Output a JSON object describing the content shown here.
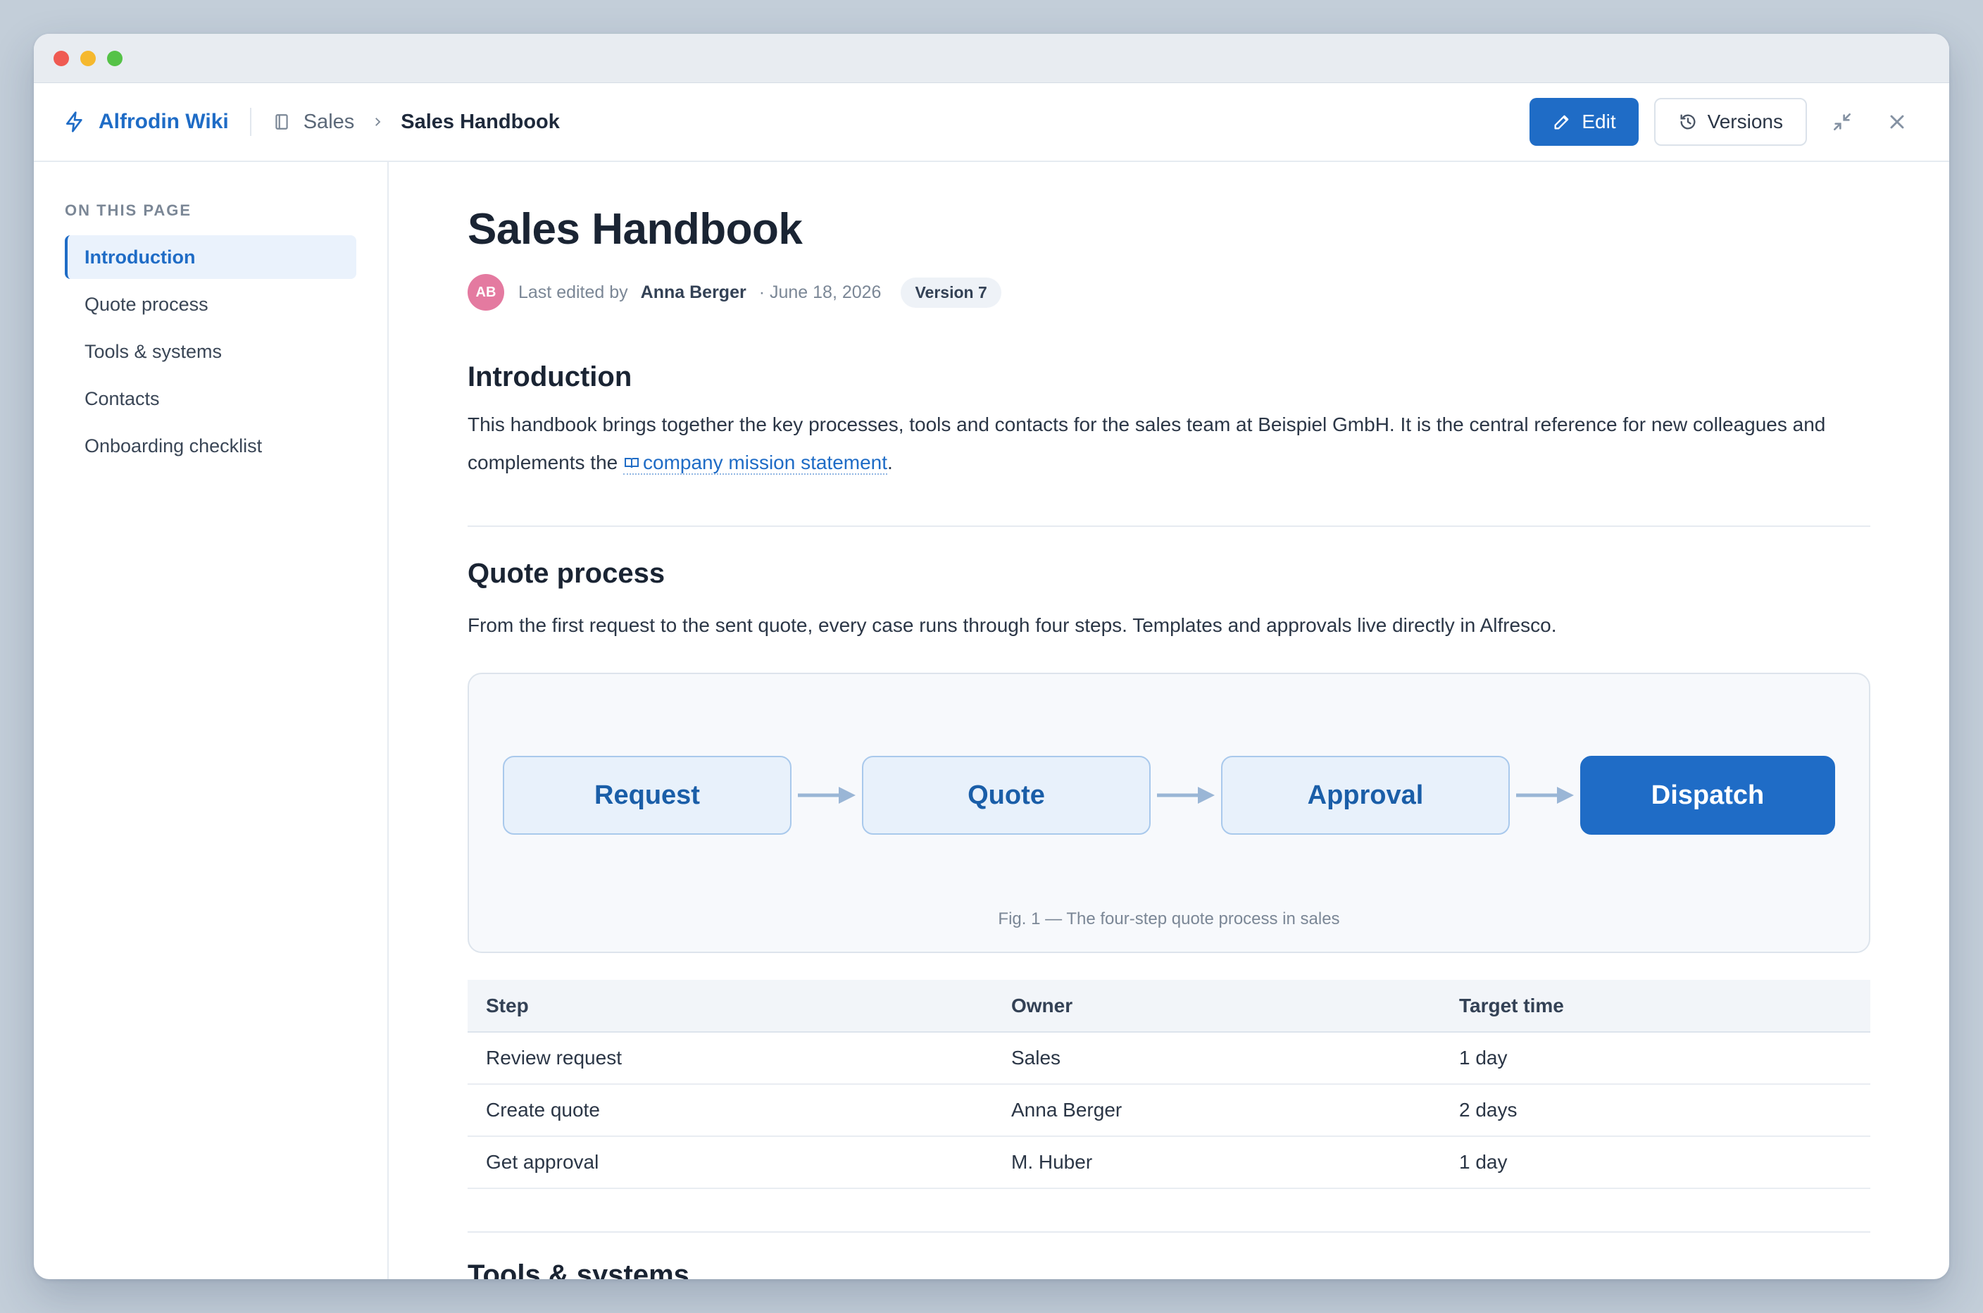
{
  "app": {
    "name": "Alfrodin Wiki"
  },
  "breadcrumb": {
    "space": "Sales",
    "page": "Sales Handbook"
  },
  "toolbar": {
    "edit_label": "Edit",
    "versions_label": "Versions"
  },
  "toc": {
    "heading": "ON THIS PAGE",
    "items": [
      {
        "label": "Introduction",
        "active": true
      },
      {
        "label": "Quote process"
      },
      {
        "label": "Tools & systems"
      },
      {
        "label": "Contacts"
      },
      {
        "label": "Onboarding checklist"
      }
    ]
  },
  "page": {
    "title": "Sales Handbook",
    "meta": {
      "avatar_initials": "AB",
      "edited_by_prefix": "Last edited by",
      "author": "Anna Berger",
      "date": "· June 18, 2026",
      "version": "Version 7"
    }
  },
  "introduction": {
    "heading": "Introduction",
    "text_before_link": "This handbook brings together the key processes, tools and contacts for the sales team at Beispiel GmbH. It is the central reference for new colleagues and complements the ",
    "link_text": "company mission statement",
    "text_after_link": "."
  },
  "quote_process": {
    "heading": "Quote process",
    "text": "From the first request to the sent quote, every case runs through four steps. Templates and approvals live directly in Alfresco.",
    "diagram": {
      "steps": [
        "Request",
        "Quote",
        "Approval",
        "Dispatch"
      ],
      "caption": "Fig. 1 — The four-step quote process in sales"
    },
    "table": {
      "headers": [
        "Step",
        "Owner",
        "Target time"
      ],
      "rows": [
        [
          "Review request",
          "Sales",
          "1 day"
        ],
        [
          "Create quote",
          "Anna Berger",
          "2 days"
        ],
        [
          "Get approval",
          "M. Huber",
          "1 day"
        ]
      ]
    }
  },
  "next_section": {
    "heading": "Tools & systems"
  },
  "colors": {
    "accent": "#1f6cc6",
    "avatar": "#e47aa0"
  }
}
